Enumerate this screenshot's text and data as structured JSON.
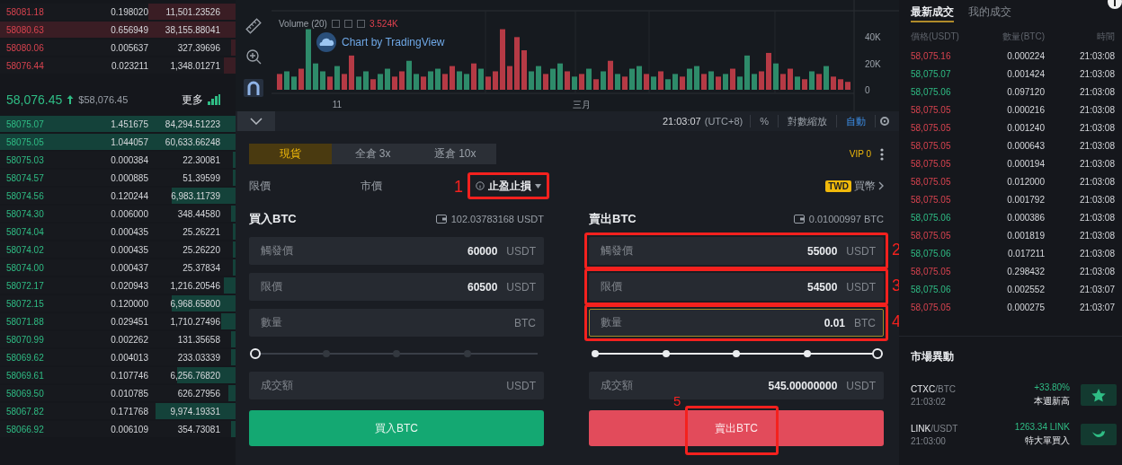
{
  "order_book": {
    "asks": [
      {
        "price": "58081.18",
        "amount": "0.198020",
        "total": "11,501.23526",
        "level": 0.37
      },
      {
        "price": "58080.63",
        "amount": "0.656949",
        "total": "38,155.88041",
        "level": 1
      },
      {
        "price": "58080.06",
        "amount": "0.005637",
        "total": "327.39696",
        "level": 0.02
      },
      {
        "price": "58076.44",
        "amount": "0.023211",
        "total": "1,348.01271",
        "level": 0.05
      }
    ],
    "last_price": {
      "price": "58,076.45",
      "usd": "$58,076.45",
      "more": "更多"
    },
    "bids": [
      {
        "price": "58075.07",
        "amount": "1.451675",
        "total": "84,294.51223",
        "level": 1
      },
      {
        "price": "58075.05",
        "amount": "1.044057",
        "total": "60,633.66248",
        "level": 1
      },
      {
        "price": "58075.03",
        "amount": "0.000384",
        "total": "22.30081",
        "level": 0.01
      },
      {
        "price": "58074.57",
        "amount": "0.000885",
        "total": "51.39599",
        "level": 0.01
      },
      {
        "price": "58074.56",
        "amount": "0.120244",
        "total": "6,983.11739",
        "level": 0.27
      },
      {
        "price": "58074.30",
        "amount": "0.006000",
        "total": "348.44580",
        "level": 0.02
      },
      {
        "price": "58074.04",
        "amount": "0.000435",
        "total": "25.26221",
        "level": 0.01
      },
      {
        "price": "58074.02",
        "amount": "0.000435",
        "total": "25.26220",
        "level": 0.01
      },
      {
        "price": "58074.00",
        "amount": "0.000437",
        "total": "25.37834",
        "level": 0.01
      },
      {
        "price": "58072.17",
        "amount": "0.020943",
        "total": "1,216.20546",
        "level": 0.05
      },
      {
        "price": "58072.15",
        "amount": "0.120000",
        "total": "6,968.65800",
        "level": 0.27
      },
      {
        "price": "58071.88",
        "amount": "0.029451",
        "total": "1,710.27496",
        "level": 0.06
      },
      {
        "price": "58070.99",
        "amount": "0.002262",
        "total": "131.35658",
        "level": 0.02
      },
      {
        "price": "58069.62",
        "amount": "0.004013",
        "total": "233.03339",
        "level": 0.02
      },
      {
        "price": "58069.61",
        "amount": "0.107746",
        "total": "6,256.76820",
        "level": 0.25
      },
      {
        "price": "58069.50",
        "amount": "0.010785",
        "total": "626.27956",
        "level": 0.03
      },
      {
        "price": "58067.82",
        "amount": "0.171768",
        "total": "9,974.19331",
        "level": 0.34
      },
      {
        "price": "58066.92",
        "amount": "0.006109",
        "total": "354.73081",
        "level": 0.02
      }
    ]
  },
  "chart": {
    "legend": {
      "title": "Volume (20)",
      "value": "3.524K"
    },
    "watermark": "Chart by TradingView",
    "chart_data": {
      "type": "bar",
      "stacked": true,
      "ylim": [
        0,
        60
      ],
      "yticks": [
        {
          "value": 0,
          "label": "0"
        },
        {
          "value": 20,
          "label": "20K"
        },
        {
          "value": 40,
          "label": "40K"
        }
      ],
      "categories": [
        null,
        null,
        null,
        null,
        null,
        null,
        null,
        null,
        "11",
        null,
        null,
        null,
        null,
        null,
        null,
        null,
        null,
        null,
        null,
        null,
        null,
        null,
        null,
        null,
        null,
        null,
        null,
        null,
        null,
        null,
        null,
        null,
        null,
        null,
        null,
        null,
        null,
        null,
        null,
        null,
        null,
        null,
        "三月",
        null,
        null,
        null,
        null,
        null,
        null,
        null,
        null,
        null,
        null,
        null,
        null,
        null,
        null,
        null,
        null,
        null,
        null,
        null,
        null,
        null,
        null,
        null,
        null,
        null,
        null,
        null,
        null,
        null,
        null,
        null,
        null,
        null,
        null,
        null,
        null,
        null
      ],
      "series": [
        {
          "color": "#2e8b6a",
          "values": [
            null,
            14,
            10,
            null,
            46,
            20,
            14,
            null,
            18,
            null,
            null,
            10,
            14,
            null,
            12,
            16,
            null,
            null,
            22,
            12,
            null,
            14,
            16,
            null,
            null,
            14,
            12,
            null,
            16,
            null,
            null,
            null,
            null,
            null,
            null,
            14,
            18,
            null,
            16,
            20,
            null,
            10,
            null,
            16,
            null,
            14,
            null,
            12,
            null,
            16,
            18,
            null,
            10,
            null,
            8,
            12,
            null,
            16,
            18,
            null,
            14,
            null,
            12,
            null,
            10,
            26,
            12,
            null,
            null,
            20,
            null,
            null,
            10,
            null,
            14,
            null,
            18,
            null,
            null,
            null
          ]
        },
        {
          "color": "#b53a45",
          "values": [
            12,
            null,
            null,
            16,
            null,
            null,
            null,
            10,
            null,
            12,
            26,
            null,
            null,
            8,
            null,
            null,
            10,
            14,
            null,
            null,
            10,
            null,
            null,
            12,
            18,
            null,
            null,
            20,
            null,
            10,
            14,
            46,
            18,
            40,
            30,
            null,
            null,
            12,
            null,
            null,
            14,
            null,
            12,
            null,
            8,
            null,
            22,
            null,
            10,
            null,
            null,
            12,
            null,
            14,
            null,
            null,
            10,
            null,
            null,
            12,
            null,
            10,
            null,
            16,
            null,
            null,
            null,
            14,
            28,
            null,
            12,
            16,
            null,
            8,
            null,
            12,
            null,
            10,
            8,
            6
          ]
        }
      ]
    }
  },
  "chart_toolbar": {
    "time": "21:03:07",
    "timezone": "(UTC+8)",
    "items": [
      {
        "label": "%",
        "selected": false
      },
      {
        "label": "對數縮放",
        "selected": false
      },
      {
        "label": "自動",
        "selected": true
      }
    ]
  },
  "trade_form": {
    "margin_tabs": [
      {
        "label": "現貨",
        "selected": true
      },
      {
        "label": "全倉 3x",
        "selected": false
      },
      {
        "label": "逐倉 10x",
        "selected": false
      }
    ],
    "vip": "VIP 0",
    "order_types": [
      {
        "label": "限價",
        "selected": false
      },
      {
        "label": "市價",
        "selected": false
      },
      {
        "label": "止盈止損",
        "selected": true,
        "annotation": "1"
      }
    ],
    "buy_crypto": {
      "badge": "TWD",
      "label": "買幣"
    },
    "sides": [
      {
        "kind": "buy",
        "title": "買入BTC",
        "balance": "102.03783168 USDT",
        "fields": [
          {
            "label": "觸發價",
            "value": "60000",
            "unit": "USDT",
            "focused": false
          },
          {
            "label": "限價",
            "value": "60500",
            "unit": "USDT",
            "focused": false
          },
          {
            "label": "數量",
            "unit": "BTC",
            "focused": false
          }
        ],
        "slider": {
          "level": 0
        },
        "total": {
          "label": "成交額",
          "unit": "USDT"
        },
        "button": {
          "label": "買入BTC"
        }
      },
      {
        "kind": "sell",
        "title": "賣出BTC",
        "balance": "0.01000997 BTC",
        "fields": [
          {
            "label": "觸發價",
            "value": "55000",
            "unit": "USDT",
            "focused": false,
            "annotation": "2"
          },
          {
            "label": "限價",
            "value": "54500",
            "unit": "USDT",
            "focused": false,
            "annotation": "3"
          },
          {
            "label": "數量",
            "value": "0.01",
            "unit": "BTC",
            "focused": true,
            "annotation": "4"
          }
        ],
        "slider": {
          "level": 1
        },
        "total": {
          "label": "成交額",
          "value": "545.00000000",
          "unit": "USDT"
        },
        "button": {
          "label": "賣出BTC",
          "annotation": "5"
        }
      }
    ]
  },
  "trades": {
    "tabs": [
      {
        "label": "最新成交",
        "selected": true
      },
      {
        "label": "我的成交",
        "selected": false
      }
    ],
    "columns": [
      "價格(USDT)",
      "數量(BTC)",
      "時間"
    ],
    "rows": [
      {
        "kind": "sell",
        "price": "58,075.16",
        "amount": "0.000224",
        "time": "21:03:08"
      },
      {
        "kind": "buy",
        "price": "58,075.07",
        "amount": "0.001424",
        "time": "21:03:08"
      },
      {
        "kind": "buy",
        "price": "58,075.06",
        "amount": "0.097120",
        "time": "21:03:08"
      },
      {
        "kind": "sell",
        "price": "58,075.05",
        "amount": "0.000216",
        "time": "21:03:08"
      },
      {
        "kind": "sell",
        "price": "58,075.05",
        "amount": "0.001240",
        "time": "21:03:08"
      },
      {
        "kind": "sell",
        "price": "58,075.05",
        "amount": "0.000643",
        "time": "21:03:08"
      },
      {
        "kind": "sell",
        "price": "58,075.05",
        "amount": "0.000194",
        "time": "21:03:08"
      },
      {
        "kind": "sell",
        "price": "58,075.05",
        "amount": "0.012000",
        "time": "21:03:08"
      },
      {
        "kind": "sell",
        "price": "58,075.05",
        "amount": "0.001792",
        "time": "21:03:08"
      },
      {
        "kind": "buy",
        "price": "58,075.06",
        "amount": "0.000386",
        "time": "21:03:08"
      },
      {
        "kind": "sell",
        "price": "58,075.05",
        "amount": "0.001819",
        "time": "21:03:08"
      },
      {
        "kind": "buy",
        "price": "58,075.06",
        "amount": "0.017211",
        "time": "21:03:08"
      },
      {
        "kind": "sell",
        "price": "58,075.05",
        "amount": "0.298432",
        "time": "21:03:08"
      },
      {
        "kind": "buy",
        "price": "58,075.06",
        "amount": "0.002552",
        "time": "21:03:07"
      },
      {
        "kind": "sell",
        "price": "58,075.05",
        "amount": "0.000275",
        "time": "21:03:07"
      }
    ]
  },
  "market_moves": {
    "title": "市場異動",
    "items": [
      {
        "kind": "new_high",
        "pair": "CTXC",
        "quote": "/BTC",
        "time": "21:03:02",
        "change": "+33.80%",
        "event": "本週新高"
      },
      {
        "kind": "large_buy",
        "pair": "LINK",
        "quote": "/USDT",
        "time": "21:03:00",
        "change": "1263.34 LINK",
        "event": "特大單買入"
      }
    ]
  }
}
